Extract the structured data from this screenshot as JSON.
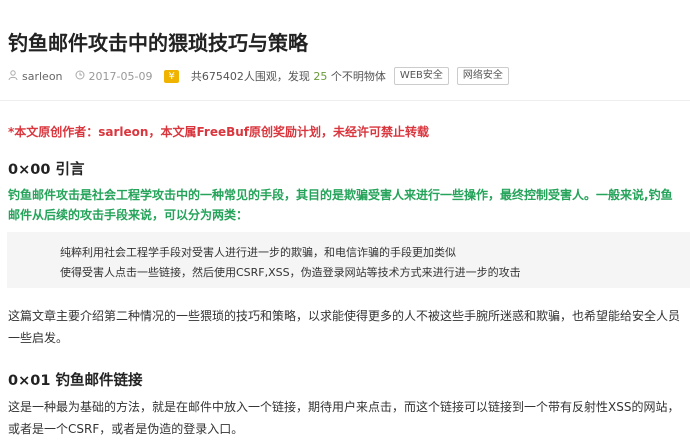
{
  "article": {
    "title": "钓鱼邮件攻击中的猥琐技巧与策略",
    "meta": {
      "author_icon": "user-icon",
      "author": "sarleon",
      "date_icon": "clock-icon",
      "date": "2017-05-09",
      "coin": "¥",
      "stats_prefix": "共",
      "views": "675402",
      "stats_mid": "人围观，发现 ",
      "finds": "25",
      "stats_suffix": " 个不明物体",
      "tags": [
        "WEB安全",
        "网络安全"
      ]
    },
    "notice": "*本文原创作者：sarleon，本文属FreeBuf原创奖励计划，未经许可禁止转载",
    "sections": [
      {
        "heading": "0×00 引言",
        "highlight": "钓鱼邮件攻击是社会工程学攻击中的一种常见的手段，其目的是欺骗受害人来进行一些操作，最终控制受害人。一般来说,钓鱼邮件从后续的攻击手段来说，可以分为两类：",
        "quote": [
          "纯粹利用社会工程学手段对受害人进行进一步的欺骗，和电信诈骗的手段更加类似",
          "使得受害人点击一些链接，然后使用CSRF,XSS，伪造登录网站等技术方式来进行进一步的攻击"
        ],
        "paragraph": "这篇文章主要介绍第二种情况的一些猥琐的技巧和策略，以求能使得更多的人不被这些手腕所迷惑和欺骗，也希望能给安全人员一些启发。"
      },
      {
        "heading": "0×01 钓鱼邮件链接",
        "paragraph": "这是一种最为基础的方法，就是在邮件中放入一个链接，期待用户来点击，而这个链接可以链接到一个带有反射性XSS的网站，或者是一个CSRF，或者是伪造的登录入口。"
      }
    ]
  },
  "colors": {
    "notice": "#d9363e",
    "highlight": "#25a35a",
    "coin": "#f0b400",
    "quote_bg": "#f5f5f5"
  }
}
